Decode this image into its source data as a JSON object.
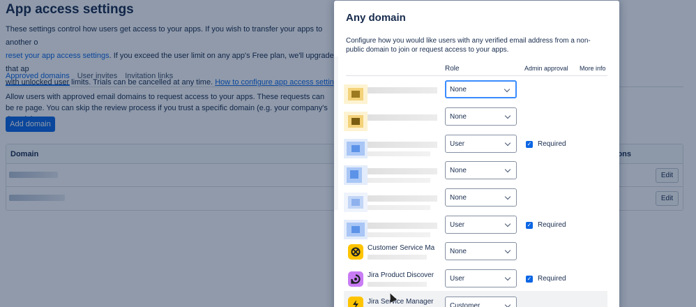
{
  "page": {
    "title": "App access settings",
    "description_1": "These settings control how users get access to your apps. If you wish to transfer your apps to another o",
    "description_link_1": "reset your app access settings",
    "description_2": ". If you exceed the user limit on any app's Free plan, we'll upgrade that ap",
    "description_3": "with unlocked user limits. Trials can be cancelled at any time.",
    "description_link_2": "How to configure app access settings",
    "tabs": [
      {
        "label": "Approved domains",
        "active": true
      },
      {
        "label": "User invites",
        "active": false
      },
      {
        "label": "Invitation links",
        "active": false
      }
    ],
    "allow_text": "Allow users with approved email domains to request access to your apps. These requests can be re page. You can skip the review process if you trust a specific domain (e.g. your company's domain)",
    "add_domain_label": "Add domain",
    "table": {
      "col_domain": "Domain",
      "col_actions": "ons",
      "rows": [
        {
          "edit_label": "Edit"
        },
        {
          "edit_label": "Edit"
        }
      ]
    }
  },
  "modal": {
    "title": "Any domain",
    "description": "Configure how you would like users with any verified email address from a non-public domain to join or request access to your apps.",
    "columns": {
      "role": "Role",
      "admin_approval": "Admin approval",
      "more_info": "More info"
    },
    "rows": [
      {
        "icon": "pixelated-yellow-icon",
        "role": "None",
        "required": false,
        "focused": true
      },
      {
        "icon": "pixelated-yellow-icon",
        "role": "None",
        "required": false,
        "focused": false
      },
      {
        "icon": "pixelated-blue-icon",
        "role": "User",
        "required": true,
        "required_label": "Required",
        "focused": false
      },
      {
        "icon": "pixelated-blue-icon",
        "role": "None",
        "required": false,
        "focused": false
      },
      {
        "icon": "pixelated-blue-icon",
        "role": "None",
        "required": false,
        "focused": false
      },
      {
        "icon": "pixelated-blue-icon",
        "role": "User",
        "required": true,
        "required_label": "Required",
        "focused": false
      },
      {
        "icon": "customer-service-icon",
        "name": "Customer Service Ma",
        "role": "None",
        "required": false,
        "focused": false
      },
      {
        "icon": "jira-product-discovery-icon",
        "name": "Jira Product Discover",
        "role": "User",
        "required": true,
        "required_label": "Required",
        "focused": false
      },
      {
        "icon": "jira-service-management-icon",
        "name": "Jira Service Manager",
        "role": "Customer",
        "required": false,
        "focused": false
      }
    ]
  },
  "colors": {
    "accent": "#0c66e4",
    "overlay": "rgba(9,30,66,0.45)",
    "yellow_icon": "#ffc400",
    "purple_icon": "#c97cf4"
  }
}
